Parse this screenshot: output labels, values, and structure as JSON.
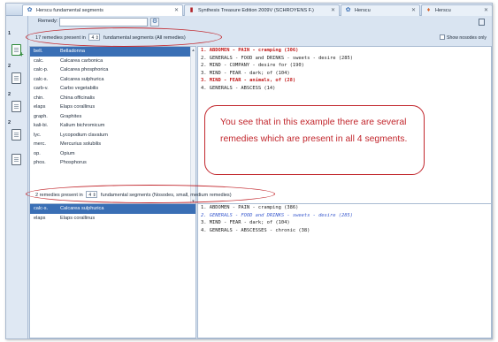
{
  "tabs": [
    {
      "label": "Herscu fundamental segments",
      "icon": "app-icon",
      "active": true
    },
    {
      "label": "Synthesis Treasure Edition 2009V (SCHROYENS F.)",
      "icon": "book-icon",
      "active": false
    },
    {
      "label": "Herscu",
      "icon": "app-icon",
      "active": false
    },
    {
      "label": "Herscu",
      "icon": "flame-icon",
      "active": false
    }
  ],
  "sidebar": {
    "numbers": [
      "1",
      "2",
      "2",
      "2"
    ]
  },
  "remedy_search": {
    "label": "Remedy:",
    "value": ""
  },
  "show_nosodes": {
    "label": "Show nosodes only",
    "checked": false
  },
  "top_section": {
    "count_text": "17 remedies present in",
    "segments_value": "4",
    "segments_text": "fundamental segments (All remedies)",
    "remedies": [
      {
        "abbr": "bell.",
        "name": "Belladonna",
        "state": "selected"
      },
      {
        "abbr": "calc.",
        "name": "Calcarea carbonica"
      },
      {
        "abbr": "calc-p.",
        "name": "Calcarea phosphorica"
      },
      {
        "abbr": "calc-s.",
        "name": "Calcarea sulphurica"
      },
      {
        "abbr": "carb-v.",
        "name": "Carbo vegetabilis"
      },
      {
        "abbr": "chin.",
        "name": "China officinalis"
      },
      {
        "abbr": "elaps",
        "name": "Elaps corallinus"
      },
      {
        "abbr": "graph.",
        "name": "Graphites"
      },
      {
        "abbr": "kali-bi.",
        "name": "Kalium bichromicum"
      },
      {
        "abbr": "lyc.",
        "name": "Lycopodium clavatum"
      },
      {
        "abbr": "merc.",
        "name": "Mercurius solubilis"
      },
      {
        "abbr": "op.",
        "name": "Opium"
      },
      {
        "abbr": "phos.",
        "name": "Phosphorus"
      }
    ],
    "rubrics": [
      {
        "text": "1. ABDOMEN - PAIN - cramping (306)",
        "style": "red"
      },
      {
        "text": "2. GENERALS - FOOD and DRINKS - sweets - desire (285)",
        "style": "normal"
      },
      {
        "text": "2. MIND - COMPANY - desire for (190)",
        "style": "normal"
      },
      {
        "text": "3. MIND - FEAR - dark; of (104)",
        "style": "normal"
      },
      {
        "text": "3. MIND - FEAR - animals, of (28)",
        "style": "red"
      },
      {
        "text": "4. GENERALS - ABSCESS (14)",
        "style": "normal"
      }
    ]
  },
  "callout": {
    "text": "You see that in this example there are several remedies which are present in all 4 segments."
  },
  "bottom_section": {
    "count_text": "2 remedies present in",
    "segments_value": "4",
    "segments_text": "fundamental segments (Nosodes, small, medium remedies)",
    "remedies": [
      {
        "abbr": "calc-s.",
        "name": "Calcarea sulphurica",
        "state": "selected"
      },
      {
        "abbr": "elaps",
        "name": "Elaps corallinus"
      }
    ],
    "rubrics": [
      {
        "text": "1. ABDOMEN - PAIN - cramping (386)",
        "style": "normal"
      },
      {
        "text": "2. GENERALS - FOOD and DRINKS - sweets - desire (285)",
        "style": "blue"
      },
      {
        "text": "3. MIND - FEAR - dark; of (104)",
        "style": "normal"
      },
      {
        "text": "4. GENERALS - ABSCESSES - chronic (38)",
        "style": "normal"
      }
    ]
  },
  "colors": {
    "accent": "#3a6fb5",
    "annotation": "#c2272d",
    "rubric_red": "#c21a1a",
    "rubric_blue": "#3c5ccf"
  }
}
